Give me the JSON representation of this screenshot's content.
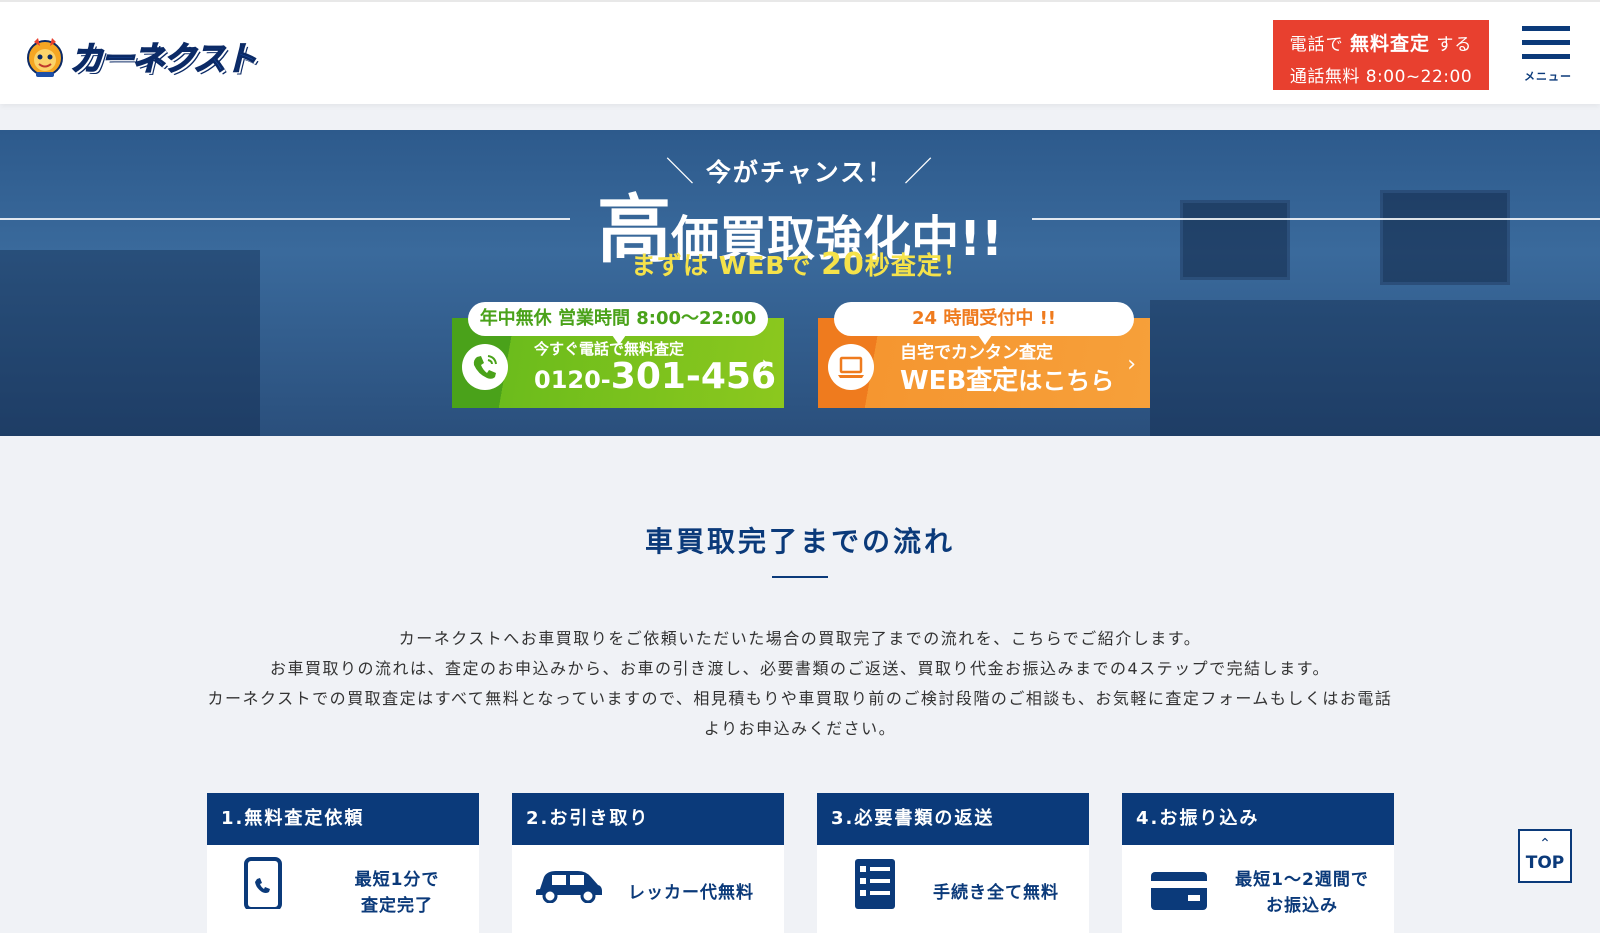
{
  "header": {
    "logo_text": "カーネクスト",
    "tel_button": {
      "prefix": "電話で",
      "strong": "無料査定",
      "suffix": "する",
      "line2": "通話無料 8:00~22:00"
    },
    "menu_label": "メニュー"
  },
  "hero": {
    "chance": "今がチャンス！",
    "headline_big": "高",
    "headline_rest": "価買取強化中!!",
    "sub_pre": "まずは WEBで ",
    "sub_num": "20",
    "sub_post": "秒査定！",
    "cta_phone": {
      "tab": "年中無休  営業時間 8:00〜22:00",
      "line1": "今すぐ電話で無料査定",
      "prefix": "0120-",
      "number": "301-456",
      "arrow": "›"
    },
    "cta_web": {
      "tab": "24 時間受付中 !!",
      "line1": "自宅でカンタン査定",
      "line2_a": "WEB査定",
      "line2_b": "はこちら",
      "arrow": "›"
    }
  },
  "flow": {
    "title": "車買取完了までの流れ",
    "intro": [
      "カーネクストへお車買取りをご依頼いただいた場合の買取完了までの流れを、こちらでご紹介します。",
      "お車買取りの流れは、査定のお申込みから、お車の引き渡し、必要書類のご返送、買取り代金お振込みまでの4ステップで完結します。",
      "カーネクストでの買取査定はすべて無料となっていますので、相見積もりや車買取り前のご検討段階のご相談も、お気軽に査定フォームもしくはお電話",
      "よりお申込みください。"
    ],
    "steps": [
      {
        "title": "1.無料査定依頼",
        "text1": "最短1分で",
        "text2": "査定完了",
        "icon": "smartphone-icon"
      },
      {
        "title": "2.お引き取り",
        "text1": "レッカー代無料",
        "text2": "",
        "icon": "car-icon"
      },
      {
        "title": "3.必要書類の返送",
        "text1": "手続き全て無料",
        "text2": "",
        "icon": "checklist-icon"
      },
      {
        "title": "4.お振り込み",
        "text1": "最短1〜2週間で",
        "text2": "お振込み",
        "icon": "credit-card-icon"
      }
    ]
  },
  "top_button": {
    "label": "TOP",
    "chevron": "⌃"
  },
  "colors": {
    "navy": "#0b3a7a",
    "red": "#e8402f",
    "green": "#6cbc1c",
    "orange": "#f59630",
    "yellow": "#f5e24a"
  }
}
